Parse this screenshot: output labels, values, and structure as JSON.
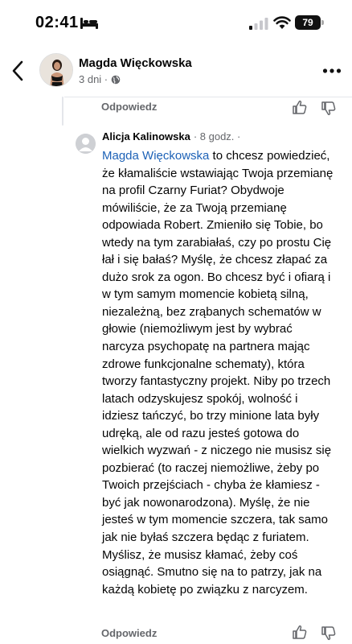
{
  "status_bar": {
    "time": "02:41",
    "battery": "79"
  },
  "header": {
    "name": "Magda Więckowska",
    "meta": "3 dni ·"
  },
  "top_reply": {
    "label": "Odpowiedz"
  },
  "comment": {
    "author": "Alicja Kalinowska",
    "time": "· 8 godz. ·",
    "mention": "Magda Więckowska",
    "text": " to chcesz powiedzieć, że kłamaliście wstawiając Twoja przemianę na profil Czarny Furiat? Obydwoje mówiliście, że za Twoją przemianę odpowiada Robert. Zmieniło się Tobie, bo wtedy na tym zarabiałaś, czy po prostu Cię łał i się bałaś? Myślę, że chcesz złapać za dużo srok za ogon. Bo chcesz być i ofiarą i w tym samym momencie kobietą silną, niezależną, bez zrąbanych schematów w głowie (niemożliwym jest by wybrać narcyza psychopatę na partnera mając zdrowe funkcjonalne schematy), która tworzy fantastyczny projekt. Niby po trzech latach odzyskujesz spokój, wolność i idziesz tańczyć, bo trzy minione lata były udręką, ale od razu jesteś gotowa do wielkich wyzwań - z niczego nie musisz się pozbierać (to raczej niemożliwe, żeby po Twoich przejściach - chyba że kłamiesz - być jak nowonarodzona). Myślę, że nie jesteś w tym momencie szczera, tak samo jak nie byłaś szczera będąc z furiatem. Myślisz, że musisz kłamać, żeby coś osiągnąć. Smutno się na to patrzy, jak na każdą kobietę po związku z narcyzem."
  },
  "bottom_reply": {
    "label": "Odpowiedz"
  },
  "icons": {
    "back": "chevron-left-icon",
    "more": "more-horizontal-icon",
    "globe": "globe-icon",
    "like": "thumbs-up-icon",
    "dislike": "thumbs-down-icon"
  },
  "colors": {
    "mention": "#1d62b7",
    "secondary_text": "#65676b",
    "divider": "#e4e6eb"
  }
}
